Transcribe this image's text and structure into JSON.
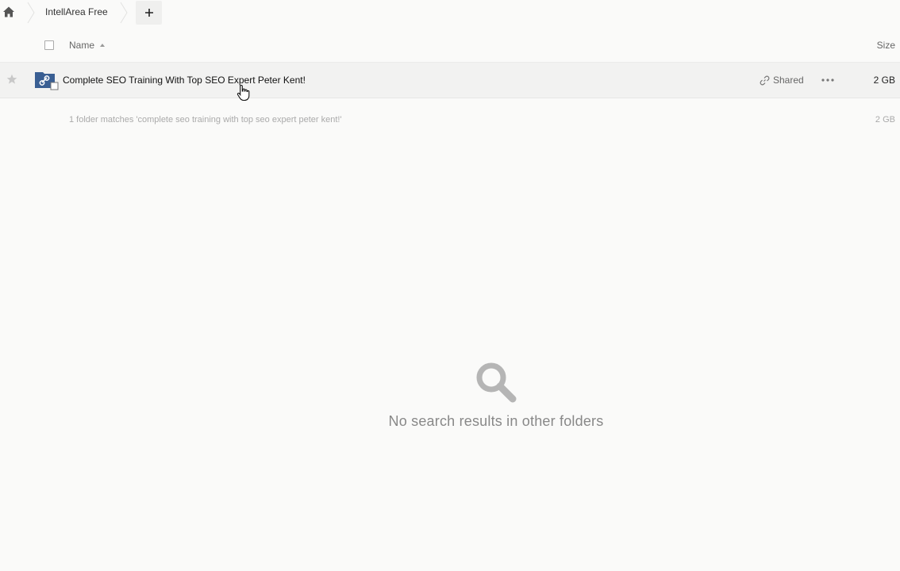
{
  "breadcrumb": {
    "home_icon": "home-icon",
    "current": "IntellArea Free",
    "add_icon": "plus-icon"
  },
  "header": {
    "name_label": "Name",
    "size_label": "Size",
    "sort_icon": "sort-ascending-icon"
  },
  "rows": [
    {
      "name": "Complete SEO Training With Top SEO Expert Peter Kent!",
      "shared_label": "Shared",
      "size": "2 GB",
      "icon": "shared-folder-icon"
    }
  ],
  "summary": {
    "text": "1 folder matches 'complete seo training with top seo expert peter kent!'",
    "size": "2 GB"
  },
  "empty_state": {
    "icon": "search-icon",
    "message": "No search results in other folders"
  },
  "colors": {
    "background": "#fafaf9",
    "row_hover": "#f2f2f1",
    "folder_blue": "#3a5f93",
    "muted_text": "#aaaaaa"
  }
}
